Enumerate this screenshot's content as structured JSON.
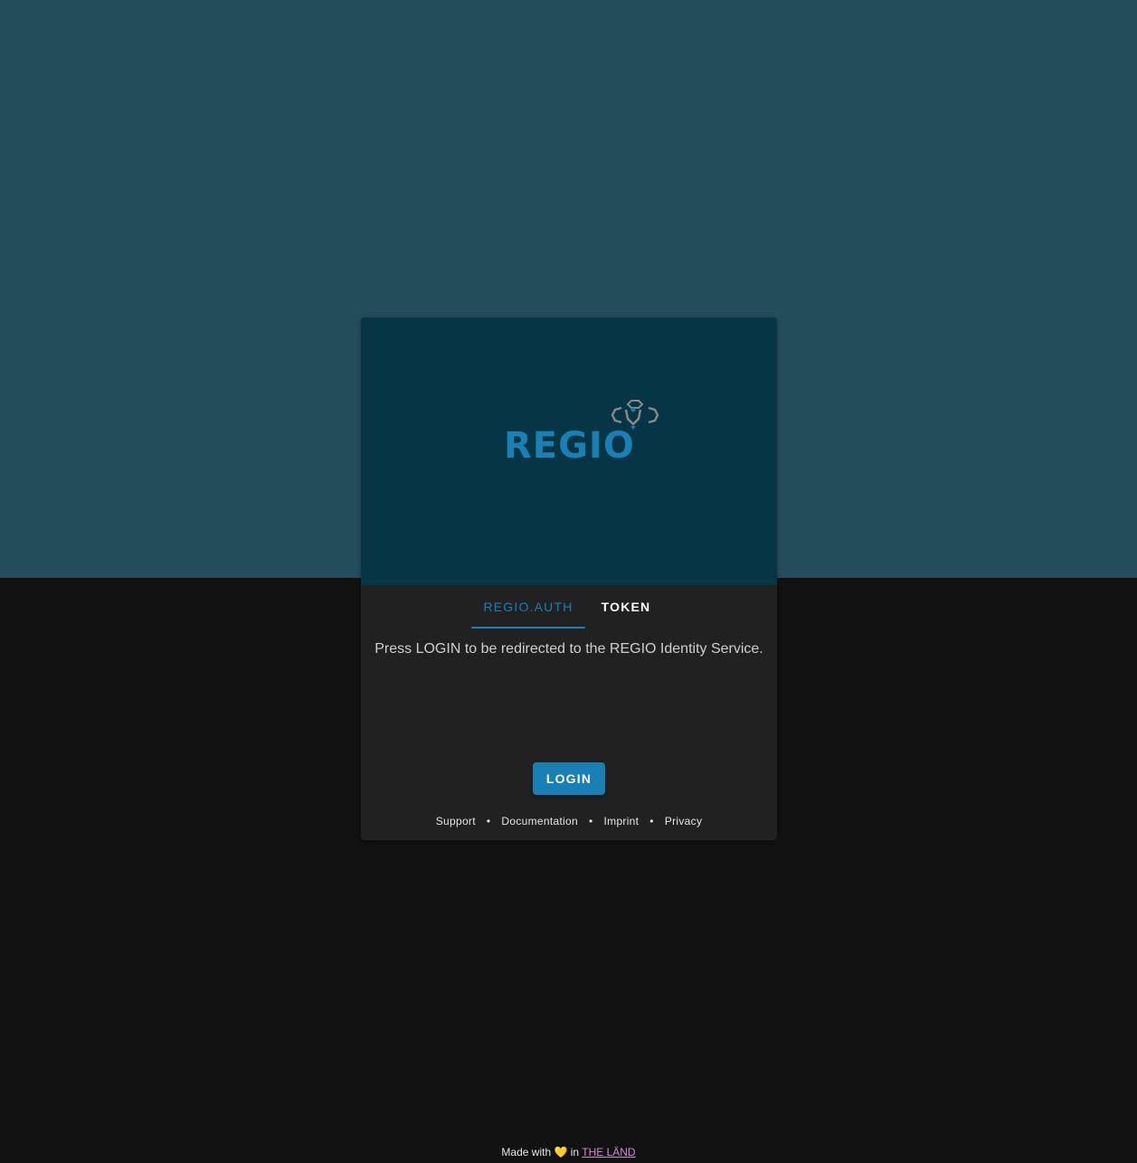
{
  "brand": {
    "logo_text": "REGIO",
    "accent_color": "#1a7fb5",
    "header_color": "#063645",
    "background_top": "#244d5b",
    "background_bottom": "#121212"
  },
  "tabs": [
    {
      "label": "REGIO.AUTH",
      "active": true
    },
    {
      "label": "TOKEN",
      "active": false
    }
  ],
  "message": "Press LOGIN to be redirected to the REGIO Identity Service.",
  "login_button": "LOGIN",
  "footer_links": [
    "Support",
    "Documentation",
    "Imprint",
    "Privacy"
  ],
  "separator": "•",
  "made_with": {
    "prefix": "Made with",
    "heart": "💛",
    "middle": "in",
    "link": "THE LÄND"
  }
}
